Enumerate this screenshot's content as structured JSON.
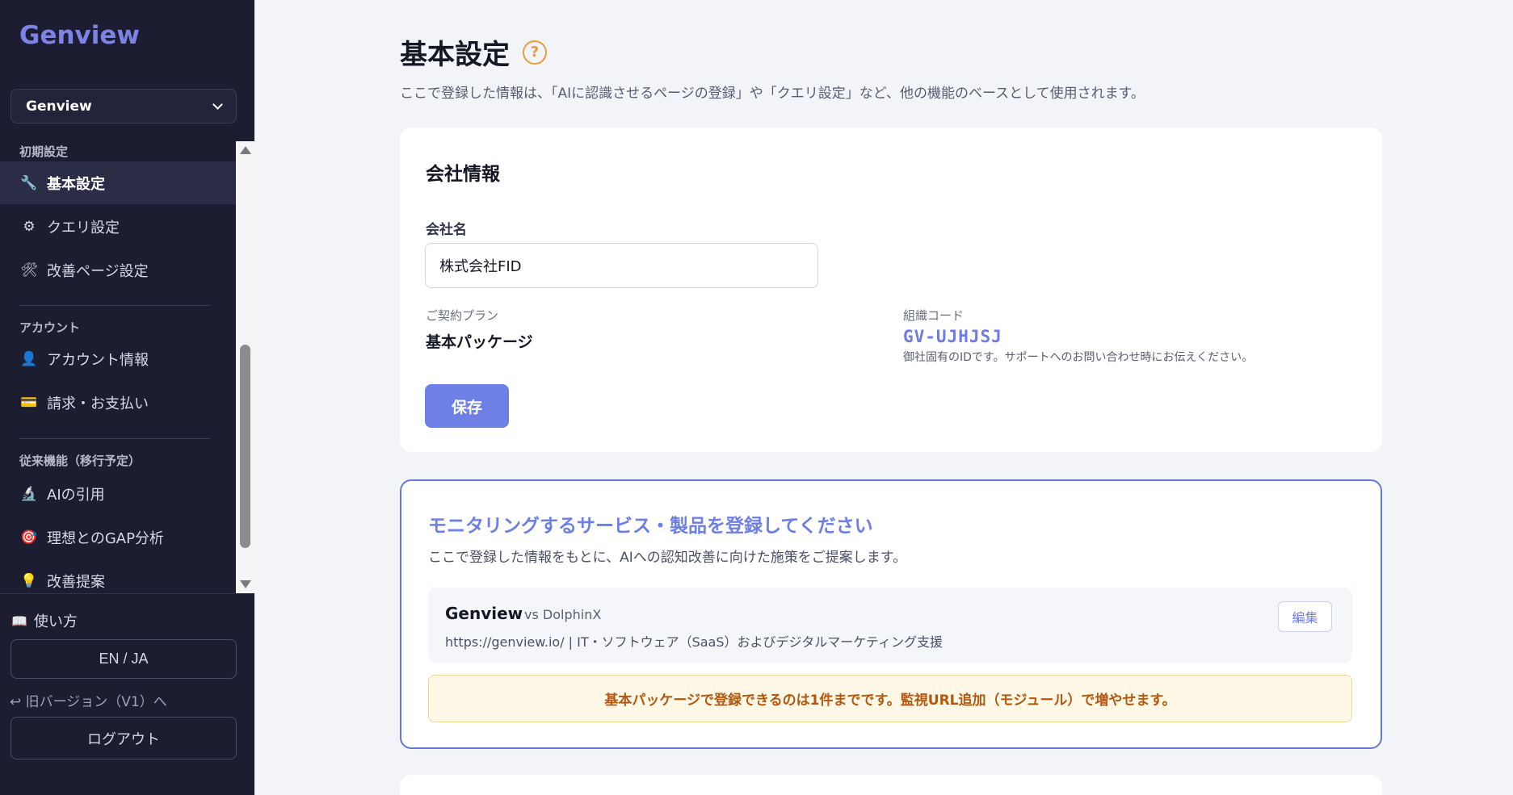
{
  "sidebar": {
    "brand": "Genview",
    "project_select": "Genview",
    "sections": [
      {
        "label": "初期設定",
        "items": [
          {
            "label": "基本設定",
            "icon": "wrench-icon",
            "glyph": "🔧",
            "active": true
          },
          {
            "label": "クエリ設定",
            "icon": "gear-icon",
            "glyph": "⚙"
          },
          {
            "label": "改善ページ設定",
            "icon": "tools-icon",
            "glyph": "🛠"
          }
        ]
      },
      {
        "label": "アカウント",
        "items": [
          {
            "label": "アカウント情報",
            "icon": "user-icon",
            "glyph": "👤"
          },
          {
            "label": "請求・お支払い",
            "icon": "credit-card-icon",
            "glyph": "💳"
          }
        ]
      },
      {
        "label": "従来機能（移行予定）",
        "items": [
          {
            "label": "AIの引用",
            "icon": "microscope-icon",
            "glyph": "🔬"
          },
          {
            "label": "理想とのGAP分析",
            "icon": "target-icon",
            "glyph": "🎯"
          },
          {
            "label": "改善提案",
            "icon": "lightbulb-icon",
            "glyph": "💡"
          }
        ]
      }
    ],
    "howto": {
      "label": "使い方",
      "glyph": "📖"
    },
    "lang_toggle": "EN / JA",
    "old_version": "↩ 旧バージョン（V1）へ",
    "logout": "ログアウト"
  },
  "main": {
    "title": "基本設定",
    "help_glyph": "?",
    "description": "ここで登録した情報は、「AIに認識させるページの登録」や「クエリ設定」など、他の機能のベースとして使用されます。",
    "company_card": {
      "title": "会社情報",
      "company_name_label": "会社名",
      "company_name_value": "株式会社FID",
      "plan_label": "ご契約プラン",
      "plan_value": "基本パッケージ",
      "org_code_label": "組織コード",
      "org_code_value": "GV-UJHJSJ",
      "org_code_note": "御社固有のIDです。サポートへのお問い合わせ時にお伝えください。",
      "save_label": "保存"
    },
    "monitoring_card": {
      "title": "モニタリングするサービス・製品を登録してください",
      "description": "ここで登録した情報をもとに、AIへの認知改善に向けた施策をご提案します。",
      "service": {
        "name": "Genview",
        "vs": "vs DolphinX",
        "meta": "https://genview.io/ | IT・ソフトウェア（SaaS）およびデジタルマーケティング支援",
        "edit_label": "編集"
      },
      "limit_note": "基本パッケージで登録できるのは1件までです。監視URL追加（モジュール）で増やせます。"
    }
  },
  "colors": {
    "sidebar_bg": "#1c1d30",
    "accent": "#6e80e6",
    "warning_text": "#b2570f",
    "help_icon": "#ec9a3c"
  }
}
